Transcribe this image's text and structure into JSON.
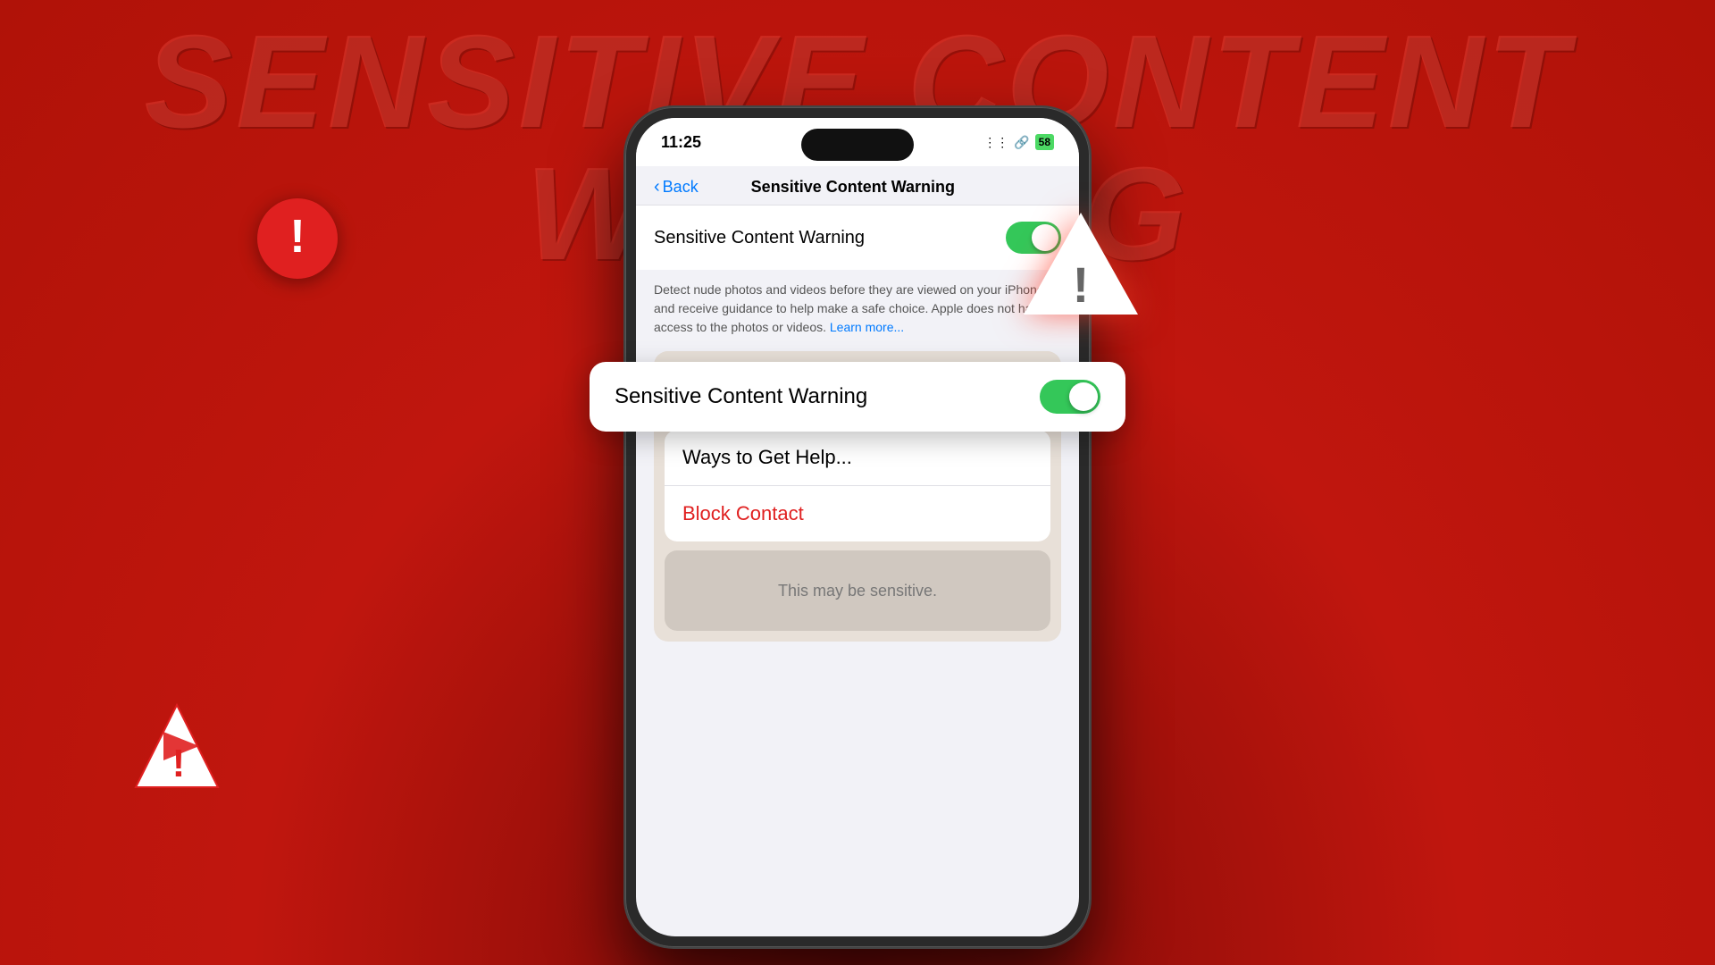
{
  "background": {
    "color": "#c0160e"
  },
  "main_title": "SENSITIVE CONTENT WARNING",
  "floating_card": {
    "label": "Sensitive Content Warning",
    "toggle_state": "on"
  },
  "phone": {
    "status_bar": {
      "time": "11:25",
      "signal": "||||",
      "battery": "58"
    },
    "nav": {
      "back_label": "Back",
      "title": "Sensitive Content Warning"
    },
    "settings_row": {
      "label": "Sensitive Content Warning",
      "toggle_state": "on"
    },
    "description": "Detect nude photos and videos before they are viewed on your iPhone, and receive guidance to help make a safe choice. Apple does not have access to the photos or videos.",
    "learn_more": "Learn more...",
    "app_icon": "R",
    "action_items": [
      {
        "label": "Ways to Get Help...",
        "color": "black"
      },
      {
        "label": "Block Contact",
        "color": "red"
      }
    ],
    "sensitive_preview_text": "This may be sensitive."
  },
  "icons": {
    "exclamation": "!",
    "warning": "⚠",
    "play": "▶"
  }
}
